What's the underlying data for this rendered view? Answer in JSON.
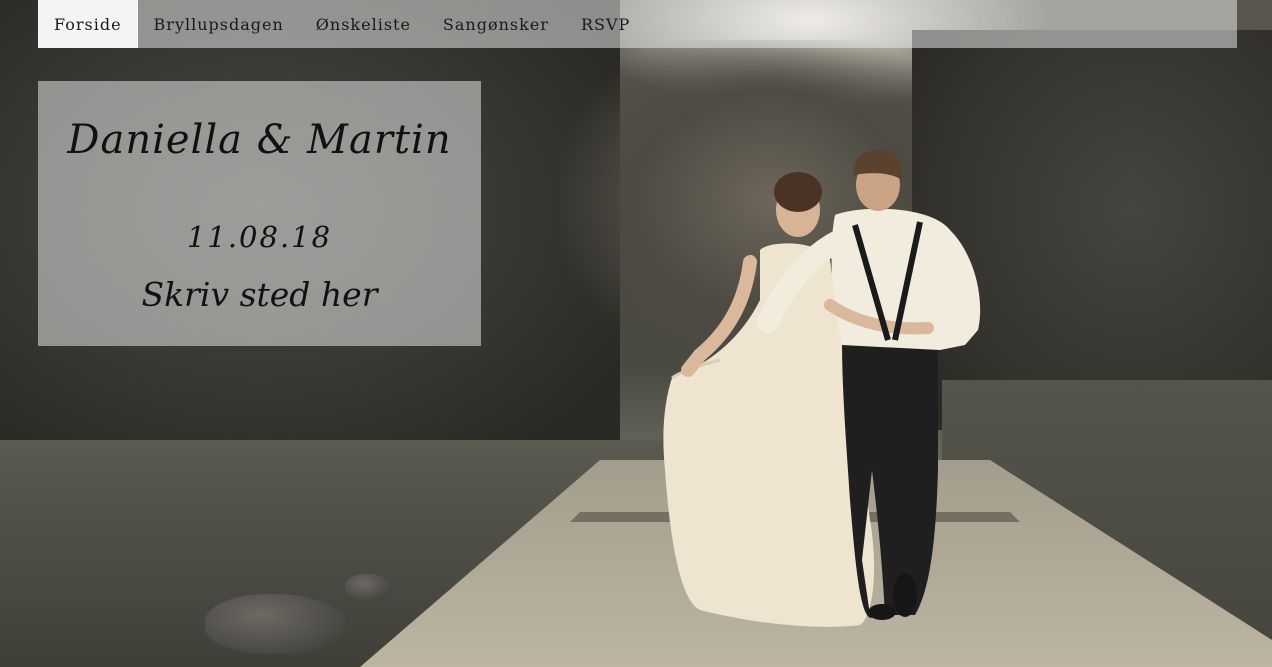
{
  "nav": {
    "items": [
      {
        "label": "Forside",
        "active": true
      },
      {
        "label": "Bryllupsdagen",
        "active": false
      },
      {
        "label": "Ønskeliste",
        "active": false
      },
      {
        "label": "Sangønsker",
        "active": false
      },
      {
        "label": "RSVP",
        "active": false
      }
    ]
  },
  "hero": {
    "names": "Daniella & Martin",
    "date": "11.08.18",
    "place": "Skriv sted her"
  },
  "colors": {
    "nav_bg": "#ebebeb",
    "nav_active_bg": "#f4f4f4",
    "text": "#111111"
  }
}
